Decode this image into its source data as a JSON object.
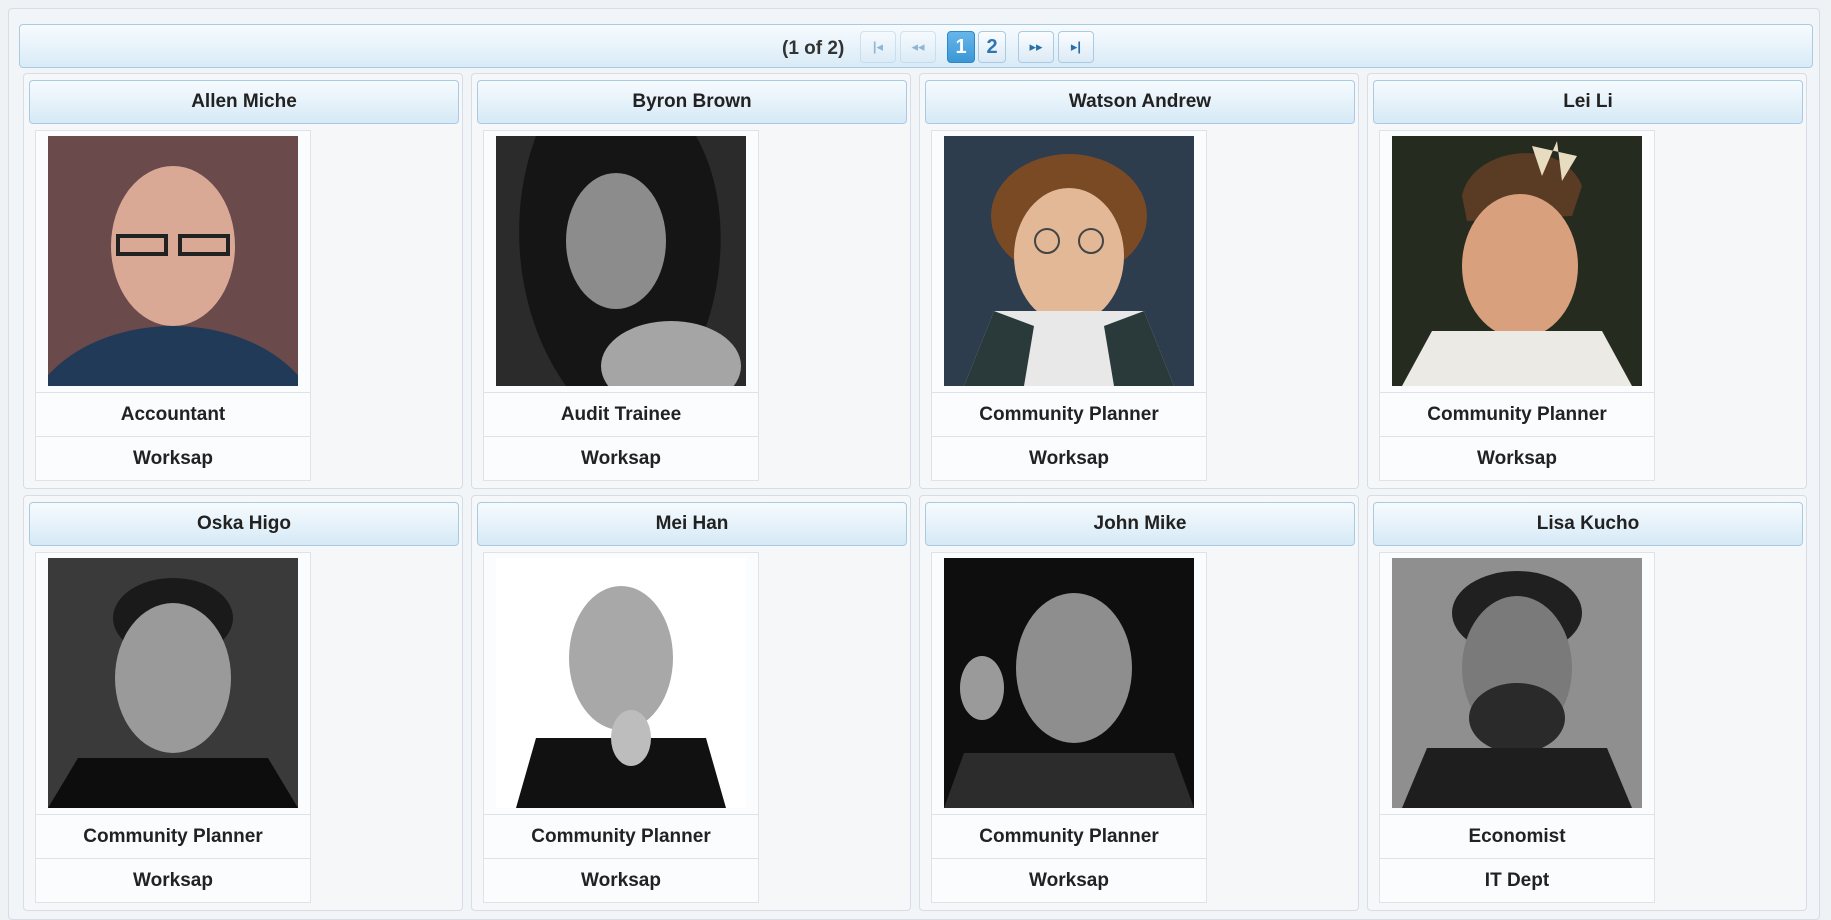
{
  "pager": {
    "status": "(1 of 2)",
    "first_icon": "first-page-icon",
    "prev_icon": "previous-page-icon",
    "next_icon": "next-page-icon",
    "last_icon": "last-page-icon",
    "pages": [
      "1",
      "2"
    ],
    "active_page": "1"
  },
  "employees": [
    {
      "name": "Allen Miche",
      "title": "Accountant",
      "dept": "Worksap"
    },
    {
      "name": "Byron Brown",
      "title": "Audit Trainee",
      "dept": "Worksap"
    },
    {
      "name": "Watson Andrew",
      "title": "Community Planner",
      "dept": "Worksap"
    },
    {
      "name": "Lei Li",
      "title": "Community Planner",
      "dept": "Worksap"
    },
    {
      "name": "Oska Higo",
      "title": "Community Planner",
      "dept": "Worksap"
    },
    {
      "name": "Mei Han",
      "title": "Community Planner",
      "dept": "Worksap"
    },
    {
      "name": "John Mike",
      "title": "Community Planner",
      "dept": "Worksap"
    },
    {
      "name": "Lisa Kucho",
      "title": "Economist",
      "dept": "IT Dept"
    }
  ]
}
